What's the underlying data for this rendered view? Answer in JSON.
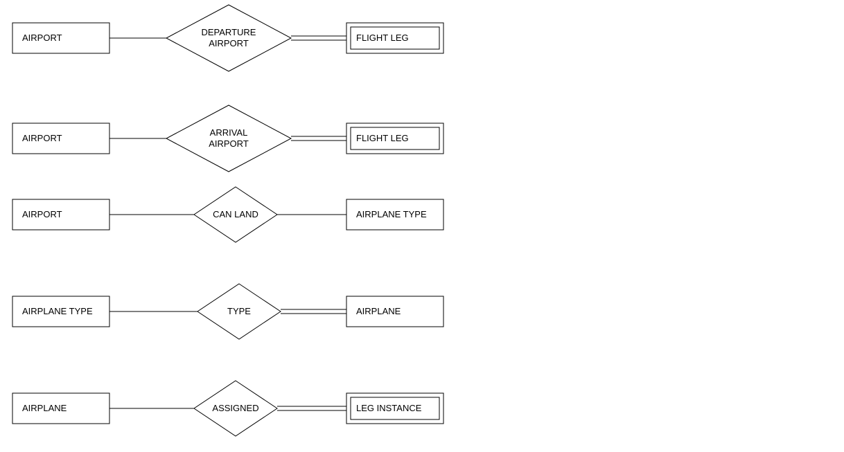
{
  "rows": [
    {
      "left": {
        "label": "AIRPORT",
        "double": false
      },
      "relationship": {
        "label": "DEPARTURE AIRPORT"
      },
      "right": {
        "label": "FLIGHT LEG",
        "double": true
      },
      "right_total": true
    },
    {
      "left": {
        "label": "AIRPORT",
        "double": false
      },
      "relationship": {
        "label": "ARRIVAL AIRPORT"
      },
      "right": {
        "label": "FLIGHT LEG",
        "double": true
      },
      "right_total": true
    },
    {
      "left": {
        "label": "AIRPORT",
        "double": false
      },
      "relationship": {
        "label": "CAN LAND"
      },
      "right": {
        "label": "AIRPLANE TYPE",
        "double": false
      },
      "right_total": false
    },
    {
      "left": {
        "label": "AIRPLANE TYPE",
        "double": false
      },
      "relationship": {
        "label": "TYPE"
      },
      "right": {
        "label": "AIRPLANE",
        "double": false
      },
      "right_total": true
    },
    {
      "left": {
        "label": "AIRPLANE",
        "double": false
      },
      "relationship": {
        "label": "ASSIGNED"
      },
      "right": {
        "label": "LEG INSTANCE",
        "double": true
      },
      "right_total": true
    }
  ]
}
